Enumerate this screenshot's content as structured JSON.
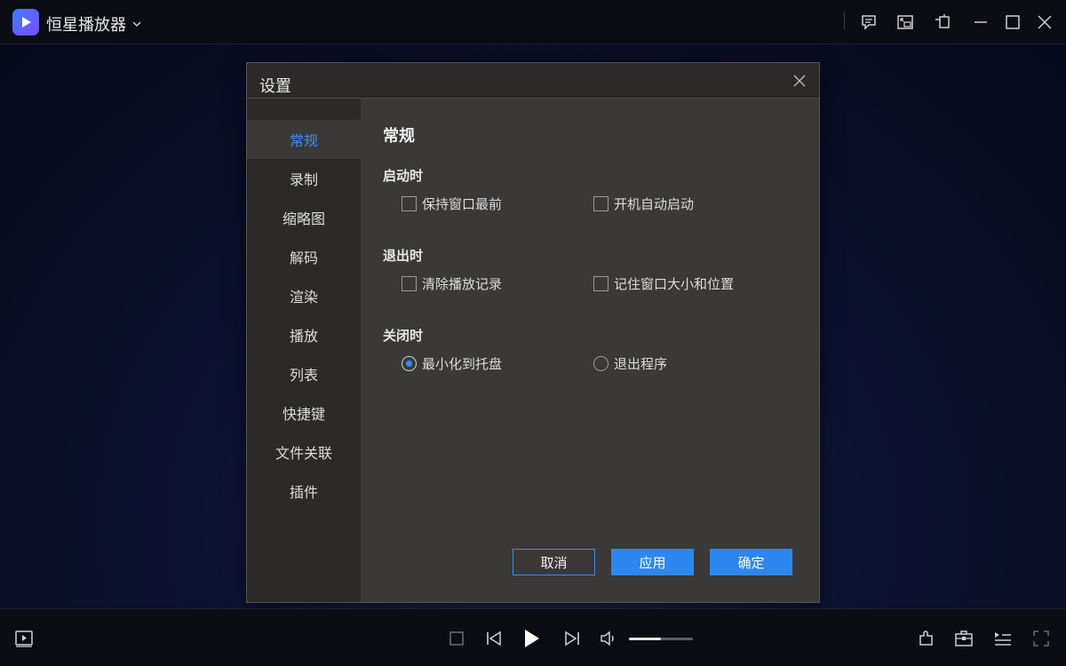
{
  "app": {
    "title": "恒星播放器",
    "accent_color": "#3b8cf5"
  },
  "titlebar": {
    "icons": [
      "chat-icon",
      "pip-icon",
      "pin-on-top-icon",
      "minimize-icon",
      "maximize-icon",
      "close-icon"
    ]
  },
  "dialog": {
    "title": "设置",
    "sidebar": [
      {
        "label": "常规",
        "active": true
      },
      {
        "label": "录制",
        "active": false
      },
      {
        "label": "缩略图",
        "active": false
      },
      {
        "label": "解码",
        "active": false
      },
      {
        "label": "渲染",
        "active": false
      },
      {
        "label": "播放",
        "active": false
      },
      {
        "label": "列表",
        "active": false
      },
      {
        "label": "快捷键",
        "active": false
      },
      {
        "label": "文件关联",
        "active": false
      },
      {
        "label": "插件",
        "active": false
      }
    ],
    "section_title": "常规",
    "groups": [
      {
        "label": "启动时",
        "options": [
          {
            "type": "checkbox",
            "label": "保持窗口最前",
            "checked": false
          },
          {
            "type": "checkbox",
            "label": "开机自动启动",
            "checked": false
          }
        ]
      },
      {
        "label": "退出时",
        "options": [
          {
            "type": "checkbox",
            "label": "清除播放记录",
            "checked": false
          },
          {
            "type": "checkbox",
            "label": "记住窗口大小和位置",
            "checked": false
          }
        ]
      },
      {
        "label": "关闭时",
        "options": [
          {
            "type": "radio",
            "label": "最小化到托盘",
            "checked": true
          },
          {
            "type": "radio",
            "label": "退出程序",
            "checked": false
          }
        ]
      }
    ],
    "buttons": {
      "cancel": "取消",
      "apply": "应用",
      "ok": "确定"
    }
  },
  "controls": {
    "volume_level": 0.5,
    "icons": [
      "playlist-toggle-icon",
      "stop-icon",
      "previous-icon",
      "play-icon",
      "next-icon",
      "volume-icon",
      "plugin-icon",
      "toolbox-icon",
      "playlist-icon",
      "fullscreen-icon"
    ]
  }
}
